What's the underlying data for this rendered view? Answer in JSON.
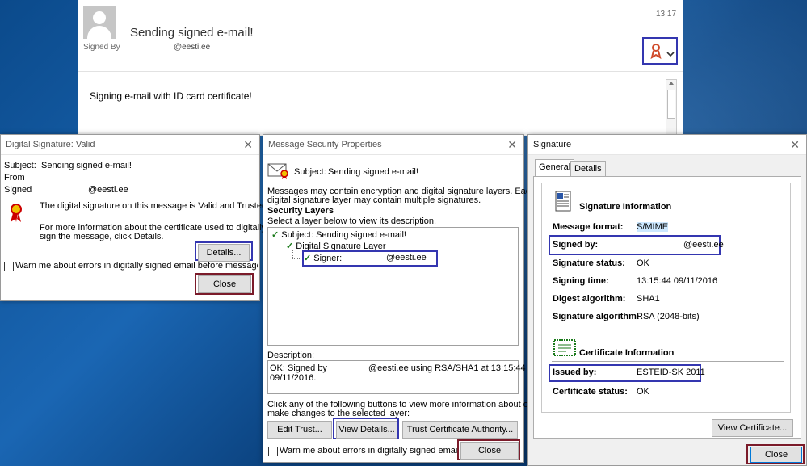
{
  "email": {
    "subject": "Sending signed e-mail!",
    "signed_by_label": "Signed By",
    "signed_by_value": "@eesti.ee",
    "time": "13:17",
    "body": "Signing e-mail with ID card certificate!"
  },
  "dialog_valid": {
    "title": "Digital Signature: Valid",
    "subject_label": "Subject:",
    "subject_value": "Sending signed e-mail!",
    "from_label": "From",
    "signed_label": "Signed",
    "signed_value": "@eesti.ee",
    "message1": "The digital signature on this message is Valid and Trusted.",
    "message2a": "For more information about the certificate used to digitally",
    "message2b": "sign the message, click Details.",
    "details_button": "Details...",
    "warn_checkbox": "Warn me about errors in digitally signed email before message opens.",
    "close_button": "Close"
  },
  "dialog_security": {
    "title": "Message Security Properties",
    "subject_label": "Subject:",
    "subject_value": "Sending signed e-mail!",
    "info_line1": "Messages may contain encryption and digital signature layers. Each",
    "info_line2": "digital signature layer may contain multiple signatures.",
    "layers_heading": "Security Layers",
    "select_text": "Select a layer below to view its description.",
    "tree": {
      "subject_item": "Subject: Sending signed e-mail!",
      "layer_item": "Digital Signature Layer",
      "signer_label": "Signer:",
      "signer_value": "@eesti.ee"
    },
    "description_label": "Description:",
    "description_line1a": "OK: Signed by",
    "description_line1b": "@eesti.ee using RSA/SHA1 at 13:15:44",
    "description_line2": "09/11/2016.",
    "click_line1": "Click any of the following buttons to view more information about or",
    "click_line2": "make changes to the selected layer:",
    "edit_trust_button": "Edit Trust...",
    "view_details_button": "View Details...",
    "trust_ca_button": "Trust Certificate Authority...",
    "warn_checkbox": "Warn me about errors in digitally signed email.",
    "close_button": "Close"
  },
  "dialog_signature": {
    "title": "Signature",
    "tabs": [
      "General",
      "Details"
    ],
    "sig_info_heading": "Signature Information",
    "rows": [
      {
        "label": "Message format:",
        "value": "S/MIME"
      },
      {
        "label": "Signed by:",
        "value": "@eesti.ee"
      },
      {
        "label": "Signature status:",
        "value": "OK"
      },
      {
        "label": "Signing time:",
        "value": "13:15:44 09/11/2016"
      },
      {
        "label": "Digest algorithm:",
        "value": "SHA1"
      },
      {
        "label": "Signature algorithm:",
        "value": "RSA (2048-bits)"
      }
    ],
    "cert_info_heading": "Certificate Information",
    "cert_rows": [
      {
        "label": "Issued by:",
        "value": "ESTEID-SK 2011"
      },
      {
        "label": "Certificate status:",
        "value": "OK"
      }
    ],
    "view_cert_button": "View Certificate...",
    "close_button": "Close"
  },
  "colors": {
    "highlight_blue": "#3436b0",
    "highlight_red": "#7b1b2a",
    "selection": "#cce8ff"
  }
}
